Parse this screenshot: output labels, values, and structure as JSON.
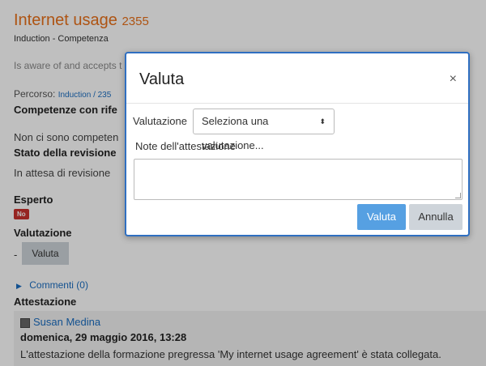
{
  "page": {
    "title": "Internet usage",
    "title_number": "2355",
    "subtitle": "Induction - Competenza",
    "description": "Is aware of and accepts t",
    "percorso_label": "Percorso:",
    "percorso_link": "Induction / 235",
    "competenze_heading": "Competenze con rife",
    "no_competenze": "Non ci sono competen",
    "stato_heading": "Stato della revisione",
    "stato_value": "In attesa di revisione",
    "esperto_heading": "Esperto",
    "esperto_badge": "No",
    "valutazione_heading": "Valutazione",
    "valutazione_dash": "-",
    "valuta_button": "Valuta",
    "commenti_link": "Commenti (0)",
    "attestazione_heading": "Attestazione",
    "attestazione": {
      "user": "Susan Medina",
      "date": "domenica, 29 maggio 2016, 13:28",
      "text": "L'attestazione della formazione pregressa 'My internet usage agreement' è stata collegata."
    }
  },
  "modal": {
    "title": "Valuta",
    "close_symbol": "×",
    "valutazione_label": "Valutazione",
    "select_value": "Seleziona una valutazione...",
    "select_arrows": "⬍",
    "note_label": "Note dell'attestazione",
    "note_value": "",
    "valuta_button": "Valuta",
    "annulla_button": "Annulla"
  },
  "colors": {
    "accent": "#e8701a",
    "link": "#1a6dc0",
    "primary_button": "#56a0e2",
    "badge": "#c9302c",
    "modal_border": "#2f6fc1"
  }
}
